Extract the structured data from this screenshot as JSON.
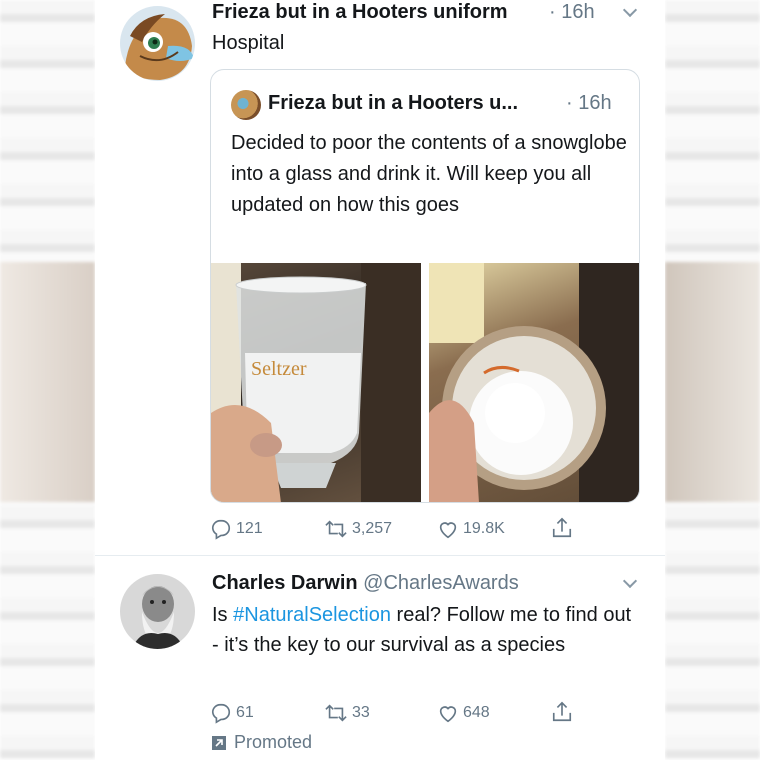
{
  "tweet1": {
    "name": "Frieza but in a Hooters uniform",
    "time": "· 16h",
    "text": "Hospital",
    "quote": {
      "name": "Frieza but in a Hooters u...",
      "time": "· 16h",
      "text": "Decided to poor the contents of a snowglobe into a glass and drink it. Will keep you all updated on how this goes",
      "glass_text": "Seltzer"
    },
    "actions": {
      "replies": "121",
      "retweets": "3,257",
      "likes": "19.8K"
    }
  },
  "tweet2": {
    "name": "Charles Darwin",
    "handle": "@CharlesAwards",
    "text_before": "Is ",
    "hashtag": "#NaturalSelection",
    "text_after": " real? Follow me to find out - it’s the key to our survival as a species",
    "actions": {
      "replies": "61",
      "retweets": "33",
      "likes": "648"
    },
    "promoted": "Promoted"
  },
  "icons": [
    "chevron-down-icon",
    "reply-icon",
    "retweet-icon",
    "like-icon",
    "share-icon",
    "promoted-icon"
  ],
  "colors": {
    "link": "#1b95e0",
    "muted": "#657786",
    "border": "#e6ecf0"
  }
}
